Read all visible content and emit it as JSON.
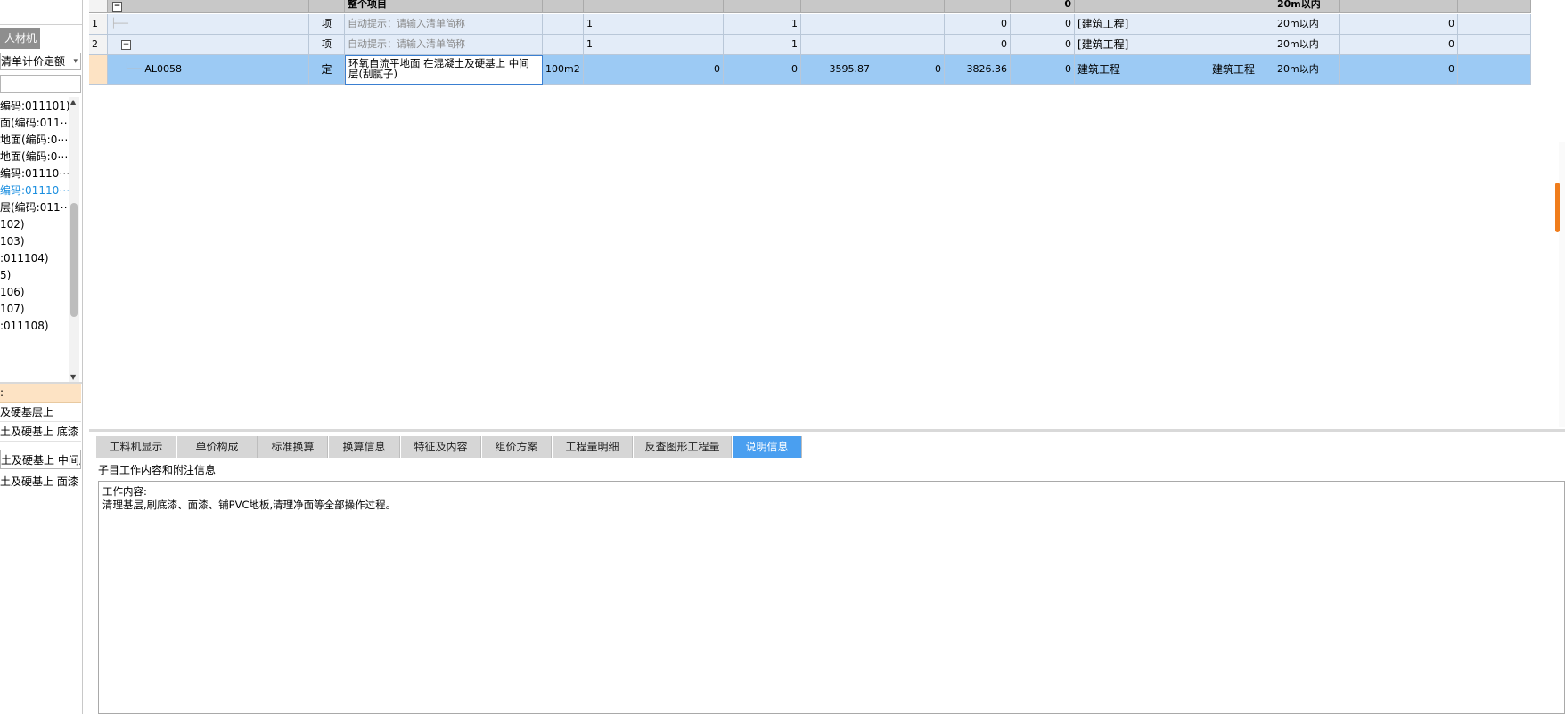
{
  "left_panel": {
    "tab_label": "人材机",
    "dropdown_value": "清单计价定额",
    "dropdown_arrow": "▾",
    "scroll_up": "▲",
    "scroll_down": "▼",
    "tree_items": [
      "编码:011101)",
      "面(编码:011⋯",
      "地面(编码:0⋯",
      "地面(编码:0⋯",
      "编码:01110⋯",
      "编码:01110⋯",
      "层(编码:011⋯",
      "102)",
      "103)",
      ":011104)",
      "5)",
      "106)",
      "107)",
      ":011108)"
    ],
    "sub_header": ":",
    "sub_items": [
      "及硬基层上",
      "土及硬基上 底漆",
      "土及硬基上 中间层",
      "土及硬基上 面漆",
      ""
    ]
  },
  "grid": {
    "header_row": {
      "collapse_icon": "−",
      "name": "整个项目",
      "col_zero": "0",
      "height_range": "20m以内"
    },
    "rows": [
      {
        "index": "1",
        "type": "项",
        "name_placeholder": "自动提示：请输入清单简称",
        "qty_expr": "1",
        "quantity": "1",
        "price_a": "0",
        "price_b": "0",
        "specialty": "[建筑工程]",
        "specialty2": "",
        "height_range": "20m以内",
        "extra": "0"
      },
      {
        "index": "2",
        "type": "项",
        "collapse_icon": "−",
        "name_placeholder": "自动提示：请输入清单简称",
        "qty_expr": "1",
        "quantity": "1",
        "price_a": "0",
        "price_b": "0",
        "specialty": "[建筑工程]",
        "specialty2": "",
        "height_range": "20m以内",
        "extra": "0"
      },
      {
        "index": "",
        "code": "AL0058",
        "type": "定",
        "name": "环氧自流平地面 在混凝土及硬基上 中间层(刮腻子)",
        "unit": "100m2",
        "v1": "0",
        "v2": "0",
        "v3": "3595.87",
        "v4": "0",
        "v5": "3826.36",
        "v6": "0",
        "specialty": "建筑工程",
        "specialty2": "建筑工程",
        "height_range": "20m以内",
        "extra": "0"
      }
    ]
  },
  "bottom": {
    "tabs": [
      "工料机显示",
      "单价构成",
      "标准换算",
      "换算信息",
      "特征及内容",
      "组价方案",
      "工程量明细",
      "反查图形工程量",
      "说明信息"
    ],
    "active_tab": "说明信息",
    "info_title": "子目工作内容和附注信息",
    "info_line1": "工作内容:",
    "info_line2": "清理基层,刷底漆、面漆、铺PVC地板,清理净面等全部操作过程。"
  },
  "colors": {
    "active_tab": "#4a9ff0",
    "selected_row": "#9ccaf4",
    "row_bg": "#e3ecf8",
    "scroll_indicator": "#f07d1c"
  }
}
